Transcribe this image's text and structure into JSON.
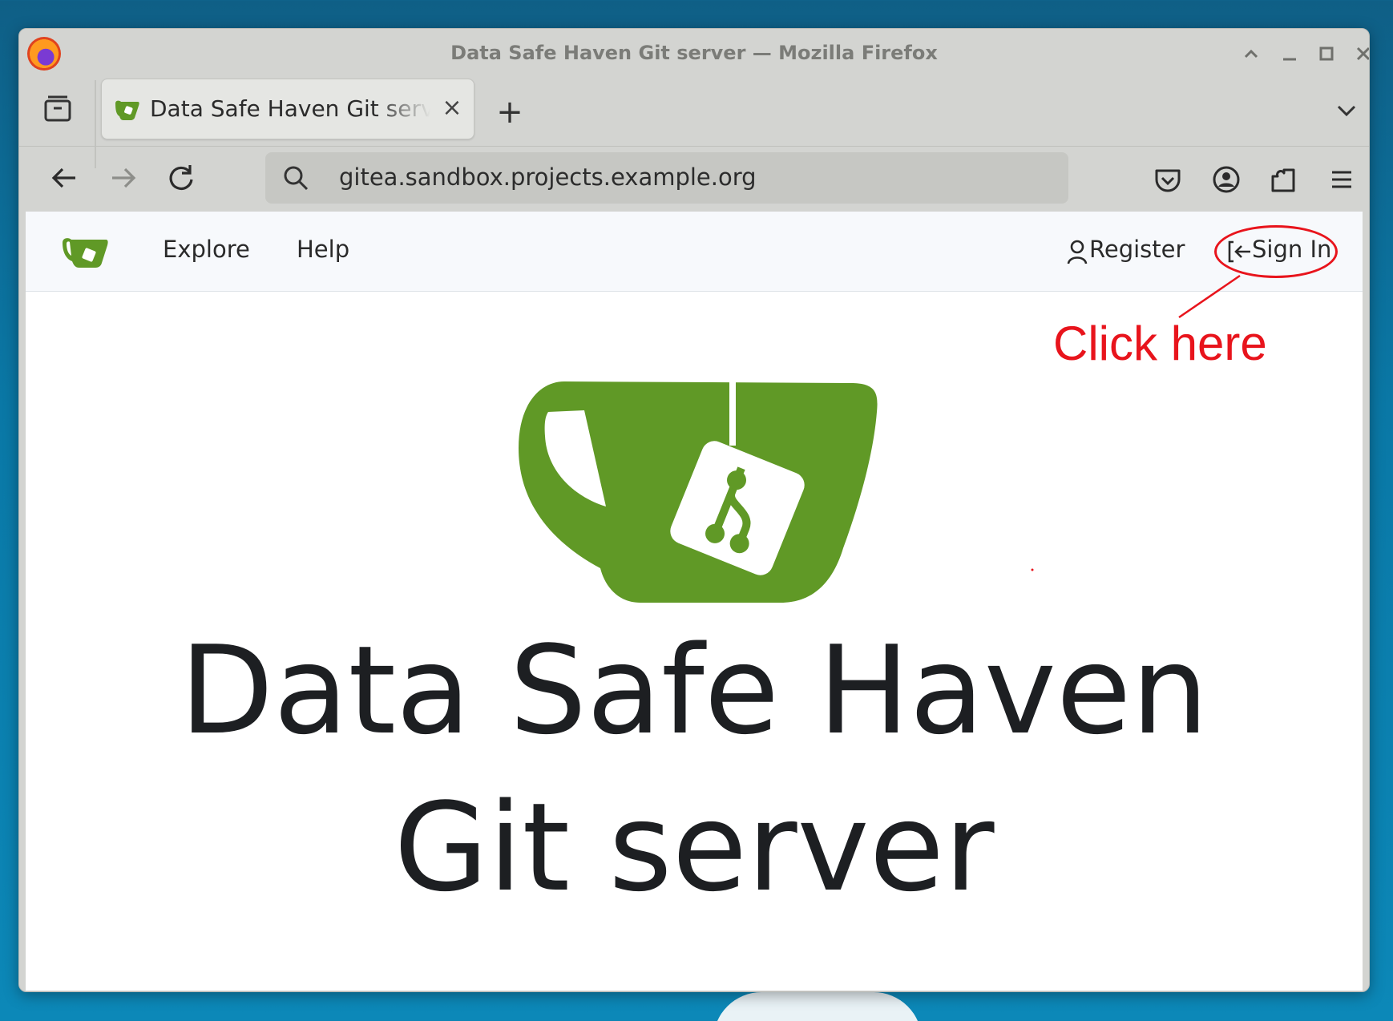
{
  "window": {
    "title": "Data Safe Haven Git server — Mozilla Firefox"
  },
  "tabs": [
    {
      "title": "Data Safe Haven Git server"
    }
  ],
  "urlbar": {
    "url": "gitea.sandbox.projects.example.org"
  },
  "gitea_nav": {
    "links": [
      "Explore",
      "Help"
    ],
    "register_label": "Register",
    "signin_label": "Sign In"
  },
  "hero": {
    "line1": "Data Safe Haven",
    "line2": "Git server"
  },
  "annotation": {
    "text": "Click here",
    "color": "#e8141c"
  },
  "colors": {
    "gitea_green": "#609926",
    "desktop": "#0a78a6"
  }
}
